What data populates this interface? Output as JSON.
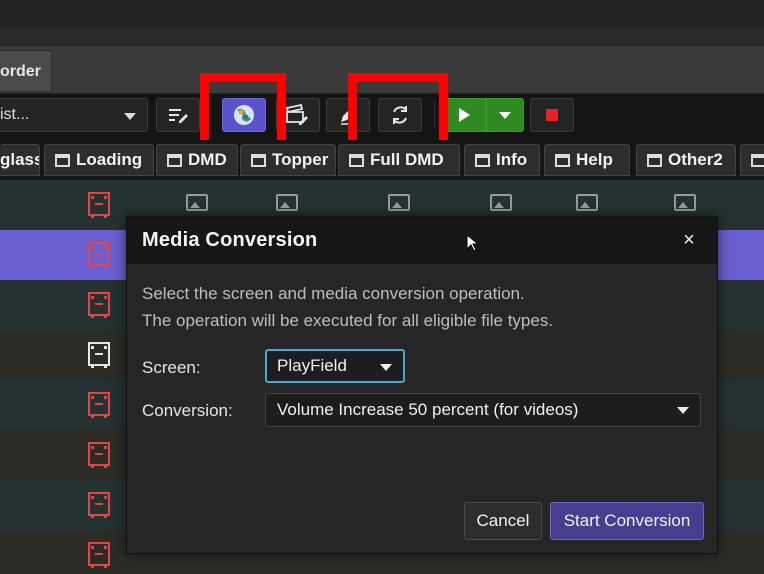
{
  "tab": {
    "label": "order"
  },
  "toolbar": {
    "playlist_value": "ist...",
    "icons": [
      "edit-list-icon",
      "globe-icon",
      "clapper-edit-icon",
      "pen-icon",
      "refresh-icon",
      "play-icon",
      "dropdown-icon",
      "stop-icon"
    ],
    "colors": {
      "active_blue": "#5b53c9",
      "play_green": "#2f8a22",
      "stop_red": "#e52222",
      "highlight": "#ff0000"
    }
  },
  "screen_tabs": [
    "glass",
    "Loading",
    "DMD",
    "Topper",
    "Full DMD",
    "Info",
    "Help",
    "Other2",
    ""
  ],
  "grid": {
    "selected_row_color": "#6a5fd0"
  },
  "dialog": {
    "title": "Media Conversion",
    "close": "×",
    "description_line1": "Select the screen and media conversion operation.",
    "description_line2": "The operation will be executed for all eligible file types.",
    "screen_label": "Screen:",
    "screen_value": "PlayField",
    "conversion_label": "Conversion:",
    "conversion_value": "Volume Increase 50 percent (for videos)",
    "cancel_label": "Cancel",
    "start_label": "Start Conversion"
  }
}
